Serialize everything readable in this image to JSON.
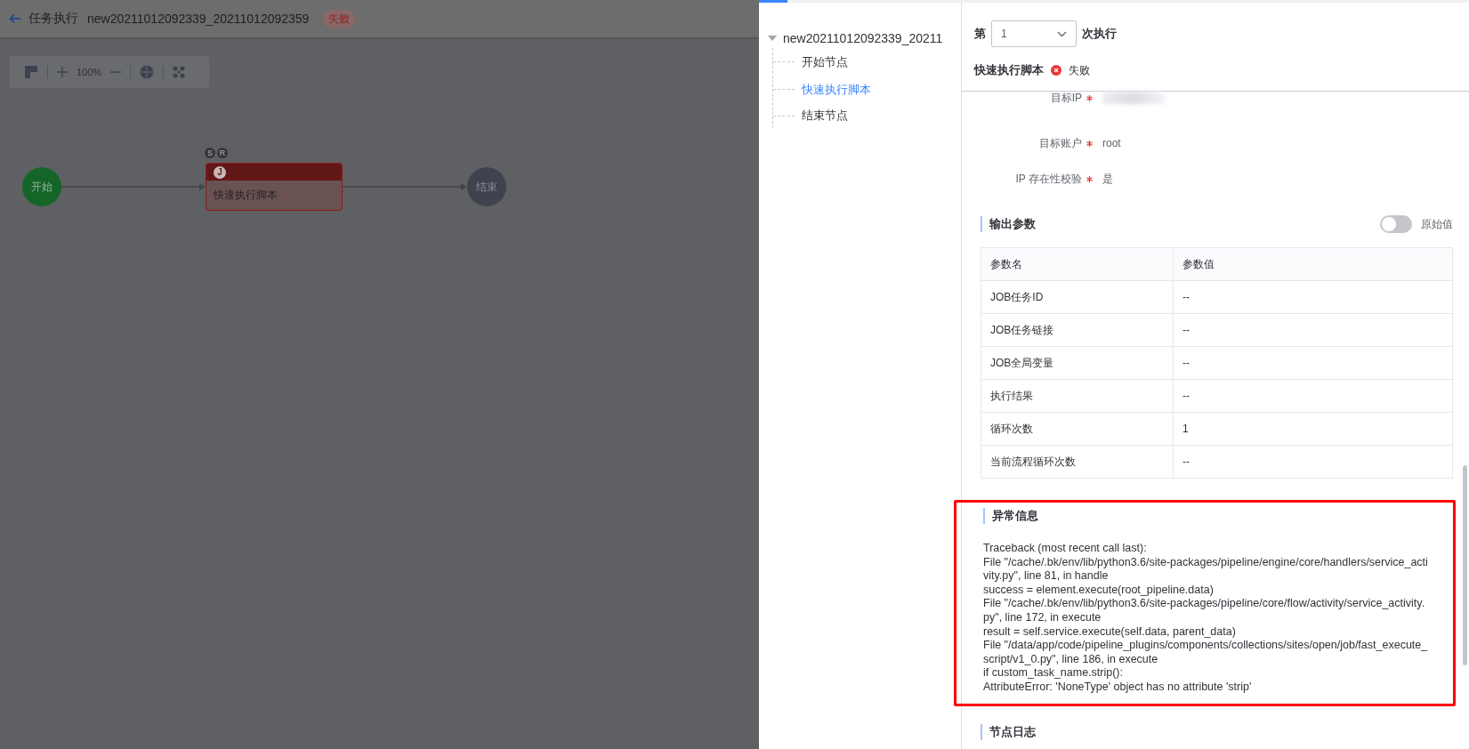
{
  "header": {
    "title": "任务执行",
    "task_name": "new20211012092339_20211012092359",
    "status": "失败"
  },
  "toolbar": {
    "zoom": "100%"
  },
  "flow": {
    "nodes": [
      {
        "kind": "start",
        "label": "开始"
      },
      {
        "kind": "task",
        "label": "快速执行脚本",
        "icon_letter": "J",
        "badges": [
          "S",
          "R"
        ],
        "failed": true
      },
      {
        "kind": "end",
        "label": "结束"
      }
    ]
  },
  "tree": {
    "root": {
      "label": "new20211012092339_20211",
      "expanded": true,
      "children": [
        {
          "label": "开始节点",
          "selected": false
        },
        {
          "label": "快速执行脚本",
          "selected": true
        },
        {
          "label": "结束节点",
          "selected": false
        }
      ]
    }
  },
  "execution": {
    "prefix": "第",
    "value": "1",
    "suffix": "次执行"
  },
  "node_status": {
    "name": "快速执行脚本",
    "failed": true,
    "status": "失败"
  },
  "inputs": [
    {
      "label": "目标IP",
      "required": true,
      "redacted": true
    },
    {
      "label": "目标账户",
      "required": true,
      "redacted": false,
      "value": "root"
    },
    {
      "label": "IP 存在性校验",
      "required": true,
      "redacted": false,
      "value": "是"
    }
  ],
  "outputs": {
    "title": "输出参数",
    "raw_toggle": {
      "label": "原始值",
      "on": false
    },
    "columns": [
      "参数名",
      "参数值"
    ],
    "rows": [
      [
        "JOB任务ID",
        "--"
      ],
      [
        "JOB任务链接",
        "--"
      ],
      [
        "JOB全局变量",
        "--"
      ],
      [
        "执行结果",
        "--"
      ],
      [
        "循环次数",
        "1"
      ],
      [
        "当前流程循环次数",
        "--"
      ]
    ]
  },
  "error": {
    "title": "异常信息",
    "highlighted": true,
    "lines": [
      "Traceback (most recent call last):",
      "File \"/cache/.bk/env/lib/python3.6/site-packages/pipeline/engine/core/handlers/service_activity.py\", line 81, in handle",
      "success = element.execute(root_pipeline.data)",
      "File \"/cache/.bk/env/lib/python3.6/site-packages/pipeline/core/flow/activity/service_activity.py\", line 172, in execute",
      "result = self.service.execute(self.data, parent_data)",
      "File \"/data/app/code/pipeline_plugins/components/collections/sites/open/job/fast_execute_script/v1_0.py\", line 186, in execute",
      "if custom_task_name.strip():",
      "AttributeError: 'NoneType' object has no attribute 'strip'"
    ]
  },
  "log": {
    "title": "节点日志"
  }
}
